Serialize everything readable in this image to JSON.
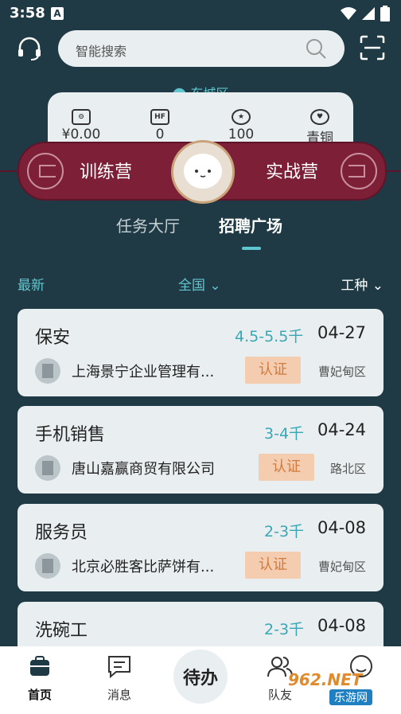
{
  "status": {
    "time": "3:58",
    "notif_icon": "A"
  },
  "search": {
    "placeholder": "智能搜索"
  },
  "location": "东城区",
  "stats": [
    {
      "icon": "wallet-icon",
      "value": "¥0.00"
    },
    {
      "icon": "hf-icon",
      "icon_text": "HF",
      "value": "0"
    },
    {
      "icon": "star-icon",
      "value": "100"
    },
    {
      "icon": "heart-icon",
      "value": "青铜"
    }
  ],
  "banner": {
    "left_label": "训练营",
    "right_label": "实战营"
  },
  "tabs": [
    {
      "label": "任务大厅",
      "active": false
    },
    {
      "label": "招聘广场",
      "active": true
    }
  ],
  "filters": {
    "latest": "最新",
    "region": "全国",
    "type": "工种"
  },
  "jobs": [
    {
      "title": "保安",
      "salary": "4.5-5.5千",
      "date": "04-27",
      "company": "上海景宁企业管理有...",
      "badge": "认证",
      "district": "曹妃甸区"
    },
    {
      "title": "手机销售",
      "salary": "3-4千",
      "date": "04-24",
      "company": "唐山嘉赢商贸有限公司",
      "badge": "认证",
      "district": "路北区"
    },
    {
      "title": "服务员",
      "salary": "2-3千",
      "date": "04-08",
      "company": "北京必胜客比萨饼有...",
      "badge": "认证",
      "district": "曹妃甸区"
    },
    {
      "title": "洗碗工",
      "salary": "2-3千",
      "date": "04-08"
    }
  ],
  "nav": {
    "home": "首页",
    "messages": "消息",
    "todo": "待办",
    "team": "队友"
  },
  "watermark": {
    "brand": "962.NET",
    "sub": "乐游网"
  },
  "colors": {
    "accent": "#5fc6d0",
    "banner": "#7c1f37",
    "badge_bg": "#f4cdb1",
    "badge_text": "#d17a3d",
    "background": "#1f3a44"
  }
}
